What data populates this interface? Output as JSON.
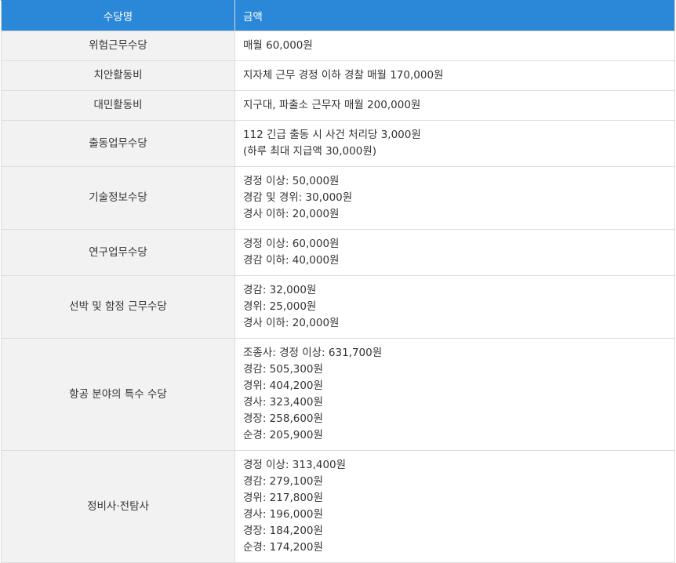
{
  "header": {
    "name": "수당명",
    "amount": "금액"
  },
  "rows": [
    {
      "name": "위험근무수당",
      "lines": [
        "매월 60,000원"
      ]
    },
    {
      "name": "치안활동비",
      "lines": [
        "지자체 근무 경정 이하 경찰 매월 170,000원"
      ]
    },
    {
      "name": "대민활동비",
      "lines": [
        "지구대, 파출소 근무자 매월 200,000원"
      ]
    },
    {
      "name": "출동업무수당",
      "lines": [
        "112 긴급 출동 시 사건 처리당 3,000원",
        "(하루 최대 지급액 30,000원)"
      ]
    },
    {
      "name": "기술정보수당",
      "lines": [
        "경정 이상: 50,000원",
        "경감 및 경위: 30,000원",
        "경사 이하: 20,000원"
      ]
    },
    {
      "name": "연구업무수당",
      "lines": [
        "경정 이상: 60,000원",
        "경감 이하: 40,000원"
      ]
    },
    {
      "name": "선박 및 함정 근무수당",
      "lines": [
        "경감: 32,000원",
        "경위: 25,000원",
        "경사 이하: 20,000원"
      ]
    },
    {
      "name": "항공 분야의 특수 수당",
      "lines": [
        "조종사: 경정 이상: 631,700원",
        "경감: 505,300원",
        "경위: 404,200원",
        "경사: 323,400원",
        "경장: 258,600원",
        "순경: 205,900원"
      ]
    },
    {
      "name": "정비사·전탐사",
      "lines": [
        "경정 이상: 313,400원",
        "경감: 279,100원",
        "경위: 217,800원",
        "경사: 196,000원",
        "경장: 184,200원",
        "순경: 174,200원"
      ]
    }
  ]
}
